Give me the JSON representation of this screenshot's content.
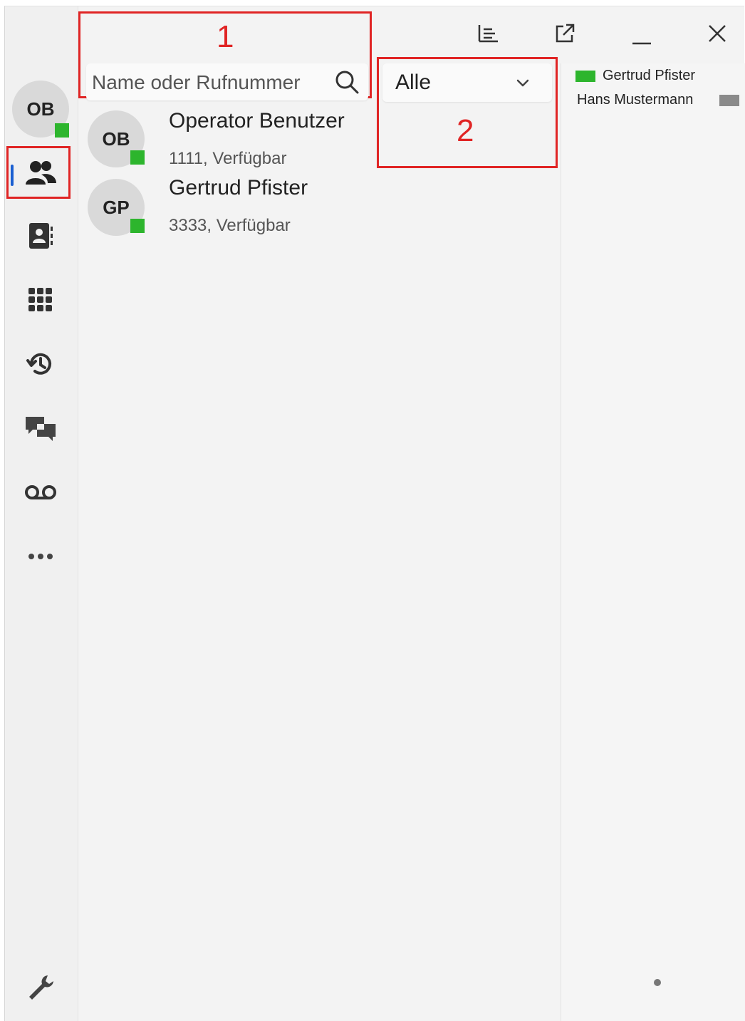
{
  "search": {
    "placeholder": "Name oder Rufnummer"
  },
  "filter": {
    "selected": "Alle"
  },
  "user": {
    "initials": "OB",
    "status_color": "#2db52d"
  },
  "contacts": [
    {
      "initials": "OB",
      "name": "Operator Benutzer",
      "sub": "1111, Verfügbar",
      "status_color": "#2db52d"
    },
    {
      "initials": "GP",
      "name": "Gertrud Pfister",
      "sub": "3333, Verfügbar",
      "status_color": "#2db52d"
    }
  ],
  "right_panel": {
    "entries": [
      {
        "name": "Gertrud Pfister",
        "color": "#2db52d"
      },
      {
        "name": "Hans Mustermann",
        "color": "#8a8a8a"
      }
    ]
  },
  "callouts": {
    "one": "1",
    "two": "2"
  },
  "rail": {
    "icons": [
      "contacts-icon",
      "address-book-icon",
      "dialpad-icon",
      "history-icon",
      "chat-icon",
      "voicemail-icon",
      "more-icon",
      "settings-wrench-icon"
    ]
  },
  "colors": {
    "accent": "#1a5fd1",
    "highlight": "#e02424",
    "available": "#2db52d"
  }
}
